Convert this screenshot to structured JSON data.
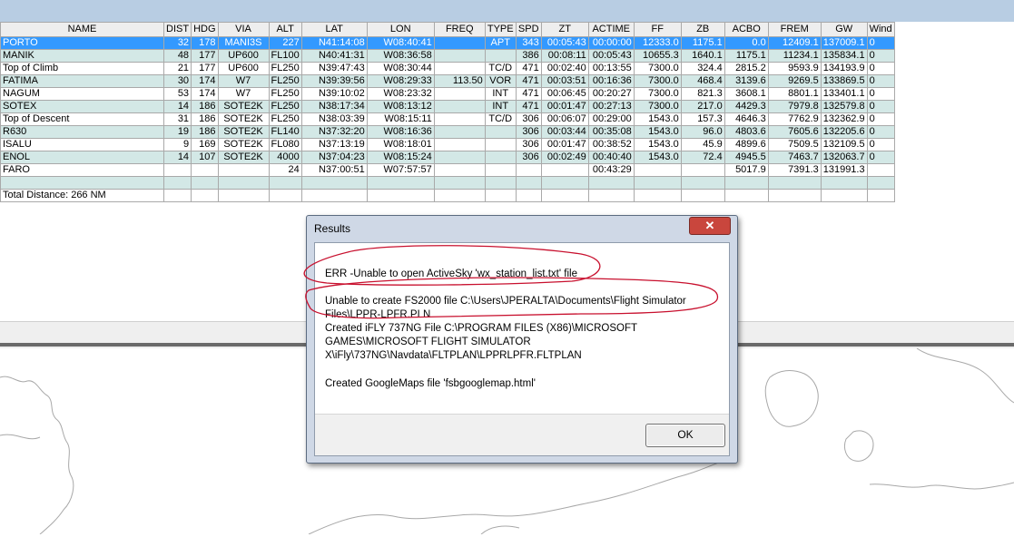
{
  "table": {
    "headers": [
      "NAME",
      "DIST",
      "HDG",
      "VIA",
      "ALT",
      "LAT",
      "LON",
      "FREQ",
      "TYPE",
      "SPD",
      "ZT",
      "ACTIME",
      "FF",
      "ZB",
      "ACBO",
      "FREM",
      "GW",
      "Wind"
    ],
    "rows": [
      [
        "PORTO",
        "32",
        "178",
        "MANI3S",
        "227",
        "N41:14:08",
        "W08:40:41",
        "",
        "APT",
        "343",
        "00:05:43",
        "00:00:00",
        "12333.0",
        "1175.1",
        "0.0",
        "12409.1",
        "137009.1",
        "0"
      ],
      [
        "MANIK",
        "48",
        "177",
        "UP600",
        "FL100",
        "N40:41:31",
        "W08:36:58",
        "",
        "",
        "386",
        "00:08:11",
        "00:05:43",
        "10655.3",
        "1640.1",
        "1175.1",
        "11234.1",
        "135834.1",
        "0"
      ],
      [
        "Top of Climb",
        "21",
        "177",
        "UP600",
        "FL250",
        "N39:47:43",
        "W08:30:44",
        "",
        "TC/D",
        "471",
        "00:02:40",
        "00:13:55",
        "7300.0",
        "324.4",
        "2815.2",
        "9593.9",
        "134193.9",
        "0"
      ],
      [
        "FATIMA",
        "30",
        "174",
        "W7",
        "FL250",
        "N39:39:56",
        "W08:29:33",
        "113.50",
        "VOR",
        "471",
        "00:03:51",
        "00:16:36",
        "7300.0",
        "468.4",
        "3139.6",
        "9269.5",
        "133869.5",
        "0"
      ],
      [
        "NAGUM",
        "53",
        "174",
        "W7",
        "FL250",
        "N39:10:02",
        "W08:23:32",
        "",
        "INT",
        "471",
        "00:06:45",
        "00:20:27",
        "7300.0",
        "821.3",
        "3608.1",
        "8801.1",
        "133401.1",
        "0"
      ],
      [
        "SOTEX",
        "14",
        "186",
        "SOTE2K",
        "FL250",
        "N38:17:34",
        "W08:13:12",
        "",
        "INT",
        "471",
        "00:01:47",
        "00:27:13",
        "7300.0",
        "217.0",
        "4429.3",
        "7979.8",
        "132579.8",
        "0"
      ],
      [
        "Top of Descent",
        "31",
        "186",
        "SOTE2K",
        "FL250",
        "N38:03:39",
        "W08:15:11",
        "",
        "TC/D",
        "306",
        "00:06:07",
        "00:29:00",
        "1543.0",
        "157.3",
        "4646.3",
        "7762.9",
        "132362.9",
        "0"
      ],
      [
        "R630",
        "19",
        "186",
        "SOTE2K",
        "FL140",
        "N37:32:20",
        "W08:16:36",
        "",
        "",
        "306",
        "00:03:44",
        "00:35:08",
        "1543.0",
        "96.0",
        "4803.6",
        "7605.6",
        "132205.6",
        "0"
      ],
      [
        "ISALU",
        "9",
        "169",
        "SOTE2K",
        "FL080",
        "N37:13:19",
        "W08:18:01",
        "",
        "",
        "306",
        "00:01:47",
        "00:38:52",
        "1543.0",
        "45.9",
        "4899.6",
        "7509.5",
        "132109.5",
        "0"
      ],
      [
        "ENOL",
        "14",
        "107",
        "SOTE2K",
        "4000",
        "N37:04:23",
        "W08:15:24",
        "",
        "",
        "306",
        "00:02:49",
        "00:40:40",
        "1543.0",
        "72.4",
        "4945.5",
        "7463.7",
        "132063.7",
        "0"
      ],
      [
        "FARO",
        "",
        "",
        "",
        "24",
        "N37:00:51",
        "W07:57:57",
        "",
        "",
        "",
        "",
        "00:43:29",
        "",
        "",
        "5017.9",
        "7391.3",
        "131991.3",
        ""
      ],
      [
        "",
        "",
        "",
        "",
        "",
        "",
        "",
        "",
        "",
        "",
        "",
        "",
        "",
        "",
        "",
        "",
        "",
        ""
      ],
      [
        "Total Distance: 266 NM",
        "",
        "",
        "",
        "",
        "",
        "",
        "",
        "",
        "",
        "",
        "",
        "",
        "",
        "",
        "",
        "",
        ""
      ]
    ]
  },
  "dialog": {
    "title": "Results",
    "close_label": "✕",
    "messages": [
      "ERR  -Unable to open ActiveSky 'wx_station_list.txt' file",
      "Unable to create FS2000 file  C:\\Users\\JPERALTA\\Documents\\Flight Simulator Files\\LPPR-LPFR.PLN",
      "Created iFLY 737NG File  C:\\PROGRAM FILES (X86)\\MICROSOFT GAMES\\MICROSOFT FLIGHT SIMULATOR X\\iFly\\737NG\\Navdata\\FLTPLAN\\LPPRLPFR.FLTPLAN",
      "Created GoogleMaps file  'fsbgooglemap.html'"
    ],
    "ok_label": "OK"
  },
  "colors": {
    "selection": "#3399ff",
    "alt_row": "#d3e8e6",
    "annotation": "#c8102e"
  }
}
